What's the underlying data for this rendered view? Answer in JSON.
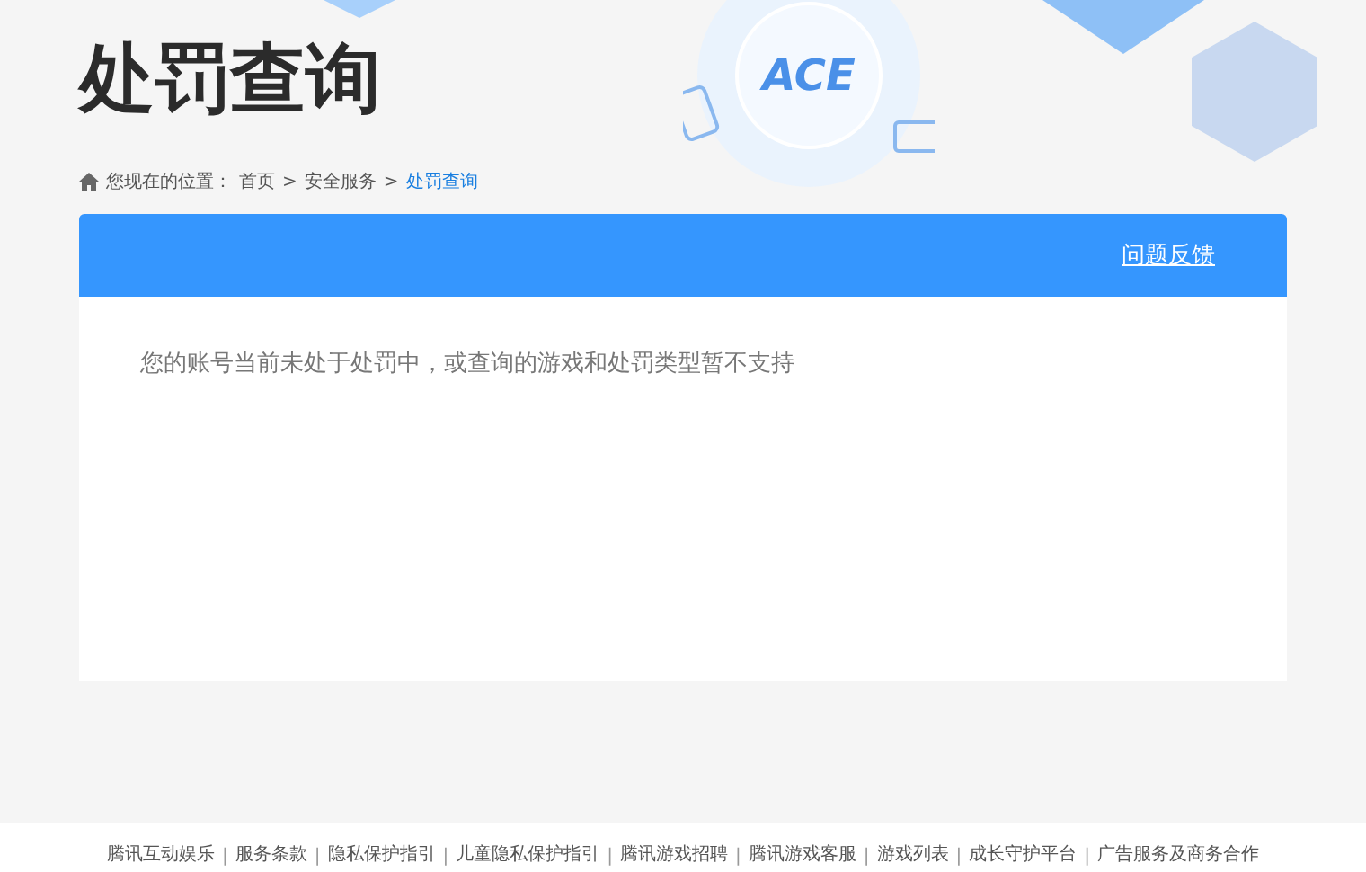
{
  "header": {
    "title": "处罚查询",
    "logo_text": "ACE"
  },
  "breadcrumb": {
    "prefix": "您现在的位置：",
    "items": [
      {
        "label": "首页",
        "selected": false
      },
      {
        "label": "安全服务",
        "selected": false
      },
      {
        "label": "处罚查询",
        "selected": true
      }
    ],
    "separator": ">"
  },
  "panel": {
    "feedback_link": "问题反馈",
    "message": "您的账号当前未处于处罚中，或查询的游戏和处罚类型暂不支持"
  },
  "footer": {
    "links": [
      "腾讯互动娱乐",
      "服务条款",
      "隐私保护指引",
      "儿童隐私保护指引",
      "腾讯游戏招聘",
      "腾讯游戏客服",
      "游戏列表",
      "成长守护平台",
      "广告服务及商务合作"
    ],
    "separator": "|"
  }
}
